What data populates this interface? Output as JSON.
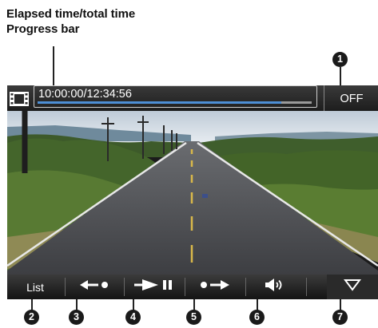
{
  "callout": {
    "line1": "Elapsed time/total time",
    "line2": "Progress bar"
  },
  "topbar": {
    "time_display": "10:00:00/12:34:56",
    "progress": 0.89,
    "off_label": "OFF",
    "film_icon": "film-icon"
  },
  "bottombar": {
    "list_label": "List",
    "buttons": [
      {
        "name": "list-button",
        "icon": "list"
      },
      {
        "name": "previous-chapter-button",
        "icon": "arrow-left-dot-icon"
      },
      {
        "name": "play-pause-button",
        "icon": "play-pause-icon"
      },
      {
        "name": "next-chapter-button",
        "icon": "dot-arrow-right-icon"
      },
      {
        "name": "volume-button",
        "icon": "speaker-icon"
      },
      {
        "name": "menu-toggle-button",
        "icon": "triangle-down-icon"
      }
    ]
  },
  "badges": [
    "1",
    "2",
    "3",
    "4",
    "5",
    "6",
    "7"
  ],
  "colors": {
    "progress_fill": "#4d8fd6",
    "bar_background": "#1d1d1d",
    "badge": "#1a1a1a"
  }
}
